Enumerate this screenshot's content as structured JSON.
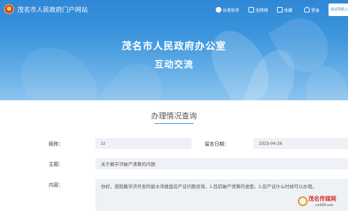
{
  "header": {
    "site_name": "茂名市人民政府门户网站",
    "toolbar": {
      "elder_mode": "长者助手",
      "accessibility": "无障碍",
      "favorites": "收藏",
      "login": "登录",
      "mobile_button": "进站导航入口"
    },
    "org_name": "茂名市人民政府办公室",
    "section_name": "互动交流"
  },
  "main": {
    "title": "办理情况查询",
    "fields": {
      "nickname_label": "昵称：",
      "nickname_value": "zz",
      "date_label": "留言日期：",
      "date_value": "2023-04-26",
      "topic_label": "主题：",
      "topic_value": "关于戴学济破产清算的问题",
      "content_label": "内容：",
      "content_value": "你好，想就戴学济开发的碧水湾楼盘房产证问题咨询，1.目前破产清算的进度。2.房产证什么时候可以办理。"
    }
  },
  "watermark": {
    "text": "茂名传媒网",
    "url": "cm668.com"
  },
  "colors": {
    "header_blue": "#2f87d6",
    "field_bg": "#eef1f5",
    "accent": "#3c95dd"
  }
}
